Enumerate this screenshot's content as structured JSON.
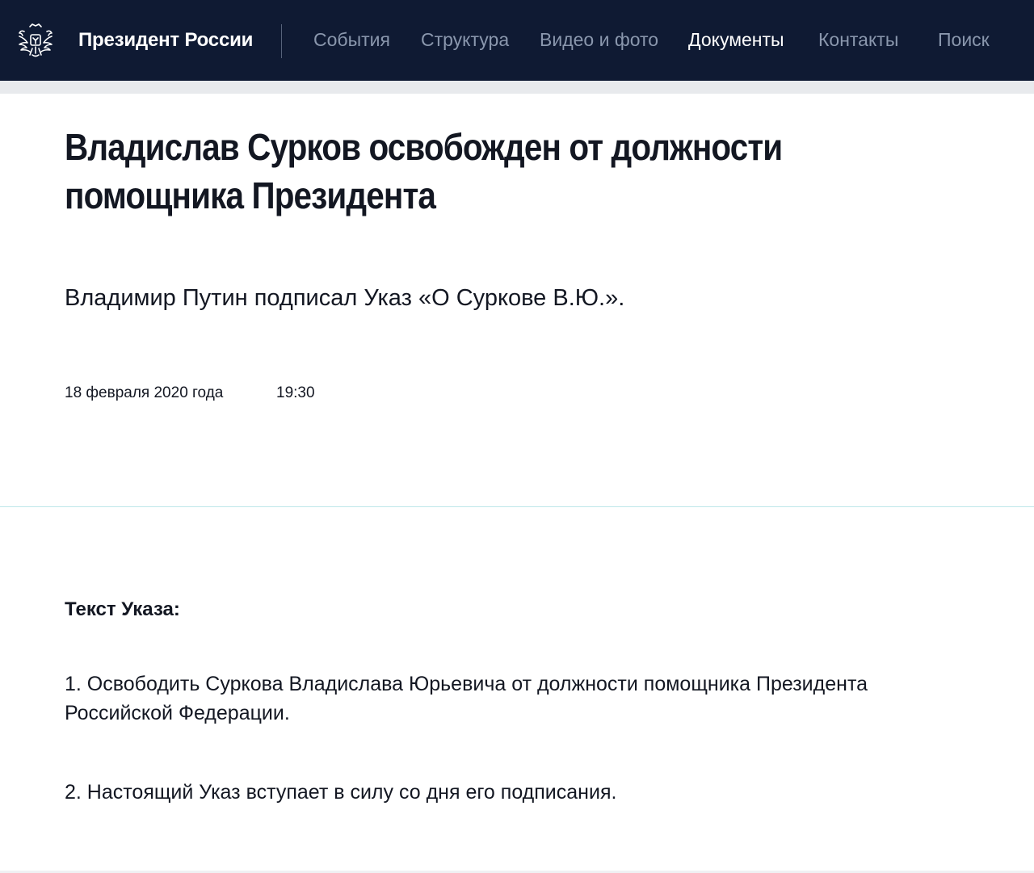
{
  "header": {
    "brand": "Президент России",
    "emblem_icon": "double-headed-eagle-icon",
    "nav": [
      {
        "label": "События",
        "active": false
      },
      {
        "label": "Структура",
        "active": false
      },
      {
        "label": "Видео и фото",
        "active": false
      },
      {
        "label": "Документы",
        "active": true
      },
      {
        "label": "Контакты",
        "active": false
      },
      {
        "label": "Поиск",
        "active": false
      }
    ],
    "colors": {
      "background": "#0f1a33",
      "nav_text": "#8a97ad",
      "active_text": "#ffffff"
    }
  },
  "article": {
    "title": "Владислав Сурков освобожден от должности помощника Президента",
    "lead": "Владимир Путин подписал Указ «О Суркове В.Ю.».",
    "date": "18 февраля 2020 года",
    "time": "19:30",
    "decree_heading": "Текст Указа:",
    "paragraphs": [
      "1. Освободить Суркова Владислава Юрьевича от должности помощника Президента Российской Федерации.",
      "2. Настоящий Указ вступает в силу со дня его подписания."
    ]
  }
}
